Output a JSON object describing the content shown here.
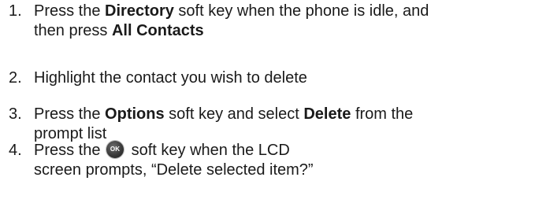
{
  "steps": [
    {
      "number": "1.",
      "line1_a": "Press the ",
      "line1_b": "Directory",
      "line1_c": " soft key when the phone is idle, and",
      "line2_a": "then press ",
      "line2_b": "All Contacts"
    },
    {
      "number": "2.",
      "line1": "Highlight the contact you wish to delete"
    },
    {
      "number": "3.",
      "line1_a": "Press the ",
      "line1_b": "Options",
      "line1_c": " soft key and select ",
      "line1_d": "Delete",
      "line1_e": " from the",
      "line2": "prompt list"
    },
    {
      "number": "4.",
      "line1_a": "Press the ",
      "icon": "ok-button-icon",
      "icon_label": "OK",
      "line1_b": " soft key when the LCD",
      "line2": "screen prompts, “Delete selected item?”"
    }
  ]
}
